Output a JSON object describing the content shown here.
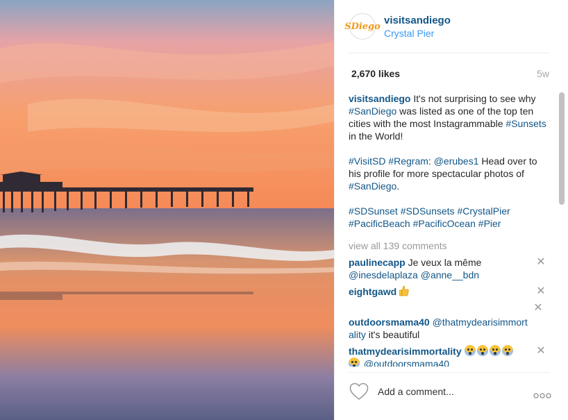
{
  "post": {
    "image_label": "Crystal Pier at sunset"
  },
  "header": {
    "avatar_text": "SDiego",
    "username": "visitsandiego",
    "location": "Crystal Pier"
  },
  "stats": {
    "likes": "2,670 likes",
    "age": "5w"
  },
  "caption": {
    "author": "visitsandiego",
    "p1_text_a": " It's not surprising to see why ",
    "p1_tag_a": "#SanDiego",
    "p1_text_b": " was listed as one of the top ten cities with the most Instagrammable ",
    "p1_tag_b": "#Sunsets",
    "p1_text_c": " in the World!",
    "p2_tag_a": "#VisitSD",
    "p2_tag_b": "#Regram",
    "p2_text_a": ": ",
    "p2_mention": "@erubes1",
    "p2_text_b": " Head over to his profile for more spectacular photos of ",
    "p2_tag_c": "#SanDiego",
    "p2_text_c": ".",
    "p3_tags": [
      "#SDSunset",
      "#SDSunsets",
      "#CrystalPier",
      "#PacificBeach",
      "#PacificOcean",
      "#Pier"
    ]
  },
  "comments": {
    "view_all": "view all 139 comments",
    "items": [
      {
        "user": "paulinecapp",
        "text": " Je veux la même ",
        "mention_a": "@inesdelaplaza",
        "mention_b": "@anne__bdn"
      },
      {
        "user": "eightgawd",
        "emoji": "thumbs-up"
      },
      {
        "user": "outdoorsmama40",
        "mention": "@thatmydearisimmortality",
        "text": " it's beautiful"
      },
      {
        "user": "thatmydearisimmortality",
        "emoji_count": 5,
        "mention": "@outdoorsmama40"
      }
    ],
    "close_glyph": "✕"
  },
  "footer": {
    "add_comment_placeholder": "Add a comment...",
    "more_glyph": "ooo"
  },
  "colors": {
    "link": "#125688",
    "location": "#3897f0",
    "muted": "#999999",
    "avatar_accent": "#f29a1c"
  }
}
